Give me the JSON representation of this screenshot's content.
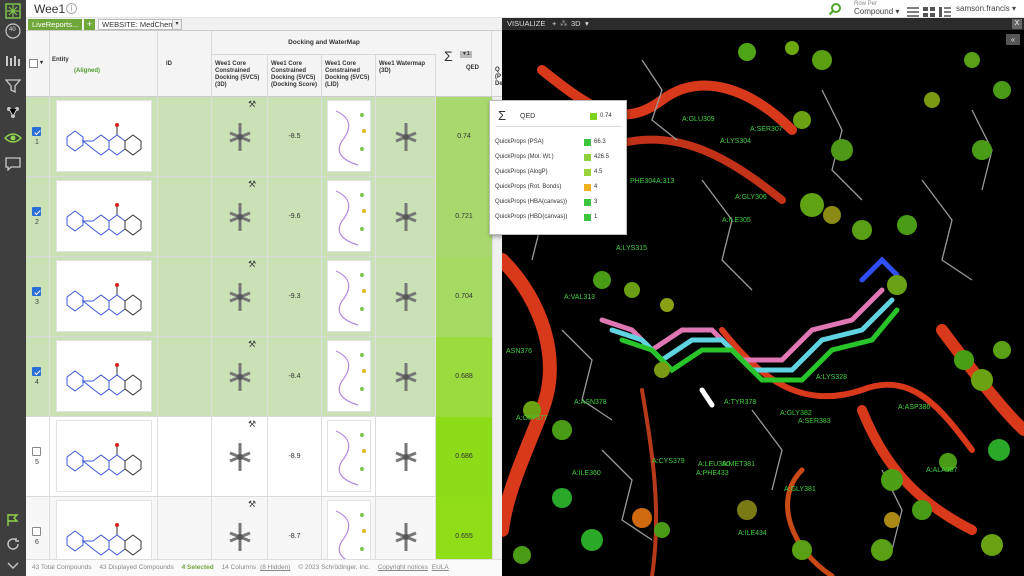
{
  "app": {
    "document_title": "Wee1",
    "rail_badge": "40"
  },
  "topbar": {
    "rows_per_label": "Row Per",
    "rows_per_value": "Compound",
    "user": "samson.francis"
  },
  "tabs": {
    "livereport": "LiveReports...",
    "add": "+",
    "website": "WEBSITE: MedChem",
    "dropdown": "▾"
  },
  "grid": {
    "columns": {
      "entity": "Entity",
      "entity_sub": "(Aligned)",
      "id": "ID",
      "group": "Docking and WaterMap",
      "col3d_1": "Wee1 Core",
      "col3d_2": "Constrained",
      "col3d_3": "Docking (5VC5)",
      "col3d_4": "(3D)",
      "colscore_1": "Wee1 Core",
      "colscore_2": "Constrained",
      "colscore_3": "Docking (5VC5)",
      "colscore_4": "(Docking Score)",
      "collid_1": "Wee1 Core",
      "collid_2": "Constrained",
      "collid_3": "Docking (5VC5)",
      "collid_4": "(LID)",
      "colwm_1": "Wee1 Watermap",
      "colwm_2": "(3D)",
      "qed": "QED",
      "qed_sort": "▼1",
      "next_1": "Q",
      "next_2": "(P",
      "next_3": "De"
    },
    "rows": [
      {
        "num": "1",
        "checked": true,
        "score": "-8.5",
        "qed": "0.74",
        "qed_color": "#a9d96e"
      },
      {
        "num": "2",
        "checked": true,
        "score": "-9.6",
        "qed": "0.721",
        "qed_color": "#a9d96e"
      },
      {
        "num": "3",
        "checked": true,
        "score": "-9.3",
        "qed": "0.704",
        "qed_color": "#a5da63"
      },
      {
        "num": "4",
        "checked": true,
        "score": "-8.4",
        "qed": "0.688",
        "qed_color": "#9bdb3e"
      },
      {
        "num": "5",
        "checked": false,
        "score": "-8.9",
        "qed": "0.686",
        "qed_color": "#8ddc1a"
      },
      {
        "num": "6",
        "checked": false,
        "score": "-8.7",
        "qed": "0.655",
        "qed_color": "#8fde18"
      }
    ]
  },
  "footer": {
    "total": "43 Total Compounds",
    "displayed": "43 Displayed Compounds",
    "selected": "4 Selected",
    "columns": "14 Columns",
    "hidden": "(8 Hidden)",
    "copyright": "© 2023 Schrödinger, Inc.",
    "notices": "Copyright notices",
    "eula": "EULA"
  },
  "visualize": {
    "label": "VISUALIZE",
    "plus": "+",
    "mode": "3D",
    "mode_caret": "▾",
    "close": "X",
    "collapse": "«",
    "residues": [
      {
        "name": "A:GLU309"
      },
      {
        "name": "A:SER307"
      },
      {
        "name": "A:LYS304"
      },
      {
        "name": "PHE304A:313"
      },
      {
        "name": "A:GLY306"
      },
      {
        "name": "A:ILE305"
      },
      {
        "name": "A:LYS315"
      },
      {
        "name": "A:VAL313"
      },
      {
        "name": "ASN376"
      },
      {
        "name": "A:ASN378"
      },
      {
        "name": "A:GLY377"
      },
      {
        "name": "A:TYR378"
      },
      {
        "name": "A:ASP386"
      },
      {
        "name": "A:GLY382"
      },
      {
        "name": "A:SER383"
      },
      {
        "name": "A:CYS379"
      },
      {
        "name": "A:ALA387"
      },
      {
        "name": "A:GLY381"
      },
      {
        "name": "A:ILE434"
      },
      {
        "name": "A:PHE433"
      },
      {
        "name": "A:LEU380"
      },
      {
        "name": "A:ILE360"
      },
      {
        "name": "A:LYS328"
      },
      {
        "name": "A:MET381"
      }
    ]
  },
  "popup": {
    "title": "QED",
    "title_value": "0.74",
    "title_color": "#7ed321",
    "props": [
      {
        "label": "QuickProps (PSA)",
        "value": "66.3",
        "color": "#3ec43e"
      },
      {
        "label": "QuickProps (Mol. Wt.)",
        "value": "426.5",
        "color": "#8fd13a"
      },
      {
        "label": "QuickProps (AlogP)",
        "value": "4.5",
        "color": "#9ad43a"
      },
      {
        "label": "QuickProps (Rot. Bonds)",
        "value": "4",
        "color": "#f0b020"
      },
      {
        "label": "QuickProps (HBA(canvas))",
        "value": "3",
        "color": "#3ec43e"
      },
      {
        "label": "QuickProps (HBD(canvas))",
        "value": "1",
        "color": "#3ec43e"
      }
    ]
  }
}
